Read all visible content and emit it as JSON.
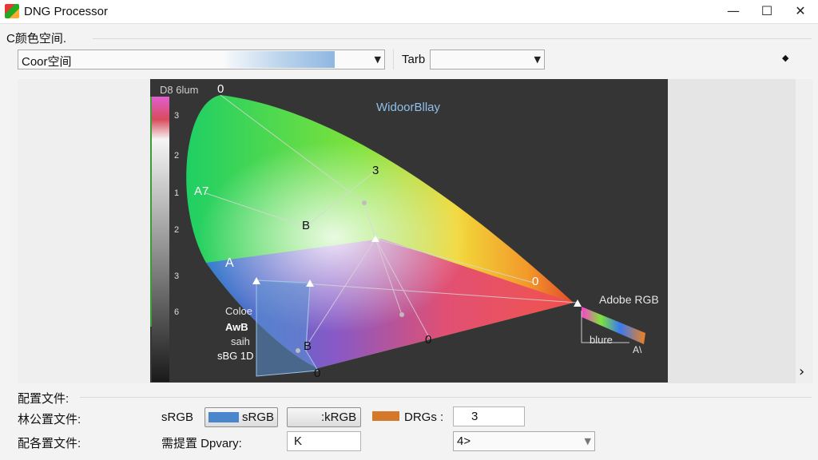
{
  "window": {
    "title": "DNG Processor",
    "minimize": "—",
    "maximize": "☐",
    "close": "✕"
  },
  "colorspace": {
    "section_label": "C颜色空间.",
    "select_value": "Coor空间",
    "target_label": "Tarb",
    "target_value": ""
  },
  "diagram": {
    "title": "WidoorBllay",
    "top_label": "D8 6lum",
    "vertex_labels": [
      "0",
      "3",
      "A7",
      "B",
      "A",
      "0",
      "0",
      "B",
      "0"
    ],
    "adobe_label": "Adobe RGB",
    "blure_label": "blure",
    "as_label": "A\\",
    "legend_lines": [
      "Coloe",
      "AwB",
      "saih",
      "sBG 1D"
    ],
    "scale_ticks": [
      "3",
      "2",
      "1",
      "2",
      "3",
      "6"
    ],
    "colors": {
      "background": "#353535",
      "accent_blue": "#5a8fd0",
      "accent_orange": "#e07020"
    }
  },
  "profile": {
    "section_label": "配置文件:",
    "row1_label": "林公置文件:",
    "row1_value": "sRGB",
    "btn1_label": "sRGB",
    "btn2_label": ":kRGB",
    "drgs_label": "DRGs :",
    "drgs_value": "3",
    "row2_label": "配各置文件:",
    "row2_sublabel": "需提置 Dpvary:",
    "row2_value": "K",
    "row2_select": "4>"
  },
  "misc": {
    "pin_glyph": "◆",
    "next_glyph": "›"
  }
}
